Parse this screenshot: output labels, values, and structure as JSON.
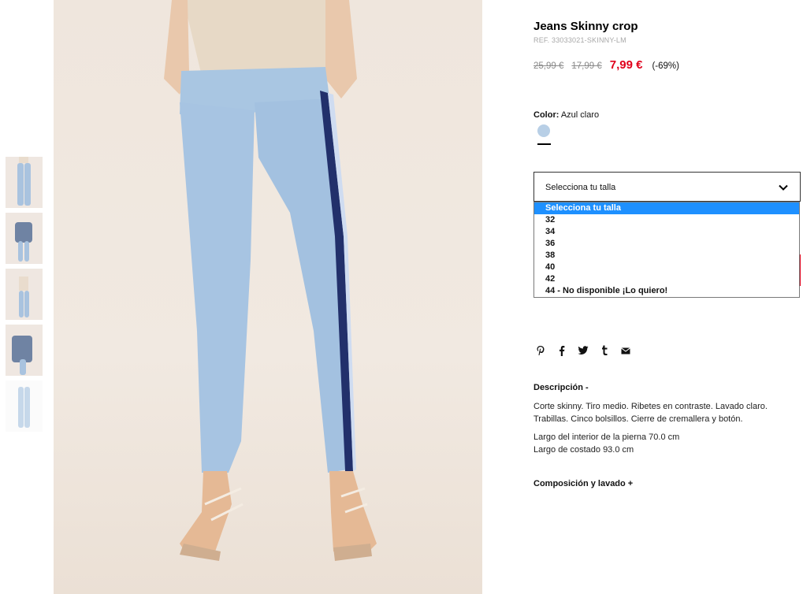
{
  "product": {
    "title": "Jeans Skinny crop",
    "ref": "REF. 33033021-SKINNY-LM",
    "price_original": "25,99 €",
    "price_previous": "17,99 €",
    "price_current": "7,99 €",
    "discount": "(-69%)"
  },
  "color": {
    "label": "Color:",
    "value": "Azul claro",
    "swatch_hex": "#b8cfe6"
  },
  "size_select": {
    "selected": "Selecciona tu talla",
    "options": [
      "Selecciona tu talla",
      "32",
      "34",
      "36",
      "38",
      "40",
      "42",
      "44 - No disponible ¡Lo quiero!"
    ]
  },
  "share_icons": [
    "pinterest-icon",
    "facebook-icon",
    "twitter-icon",
    "tumblr-icon",
    "mail-icon"
  ],
  "description": {
    "heading": "Descripción -",
    "text": "Corte skinny. Tiro medio. Ribetes en contraste. Lavado claro. Trabillas. Cinco bolsillos. Cierre de cremallera y botón.",
    "measure_1": "Largo del interior de la pierna 70.0 cm",
    "measure_2": "Largo de costado 93.0 cm"
  },
  "composition": {
    "heading": "Composición y lavado +"
  },
  "colors": {
    "accent_red": "#e0001b",
    "dropdown_highlight": "#1e90ff"
  }
}
